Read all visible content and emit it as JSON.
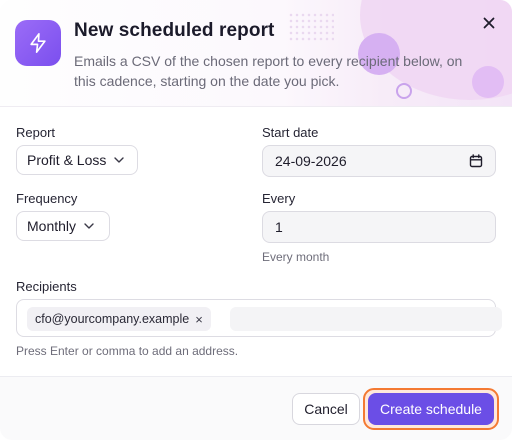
{
  "dialog": {
    "title": "New scheduled report",
    "subtitle": "Emails a CSV of the chosen report to every recipient below, on this cadence, starting on the date you pick.",
    "icon": "bolt-icon",
    "close_icon": "close-icon"
  },
  "form": {
    "report": {
      "label": "Report",
      "value": "Profit & Loss"
    },
    "start_date": {
      "label": "Start date",
      "value": "24-09-2026",
      "icon": "calendar-icon"
    },
    "frequency": {
      "label": "Frequency",
      "value": "Monthly"
    },
    "every": {
      "label": "Every",
      "value": "1",
      "hint": "Every month"
    },
    "recipients": {
      "label": "Recipients",
      "chips": [
        "cfo@yourcompany.example"
      ],
      "remove_glyph": "×",
      "hint": "Press Enter or comma to add an address."
    }
  },
  "footer": {
    "cancel_label": "Cancel",
    "create_label": "Create schedule"
  },
  "colors": {
    "accent": "#6b4ee6",
    "focus_ring": "#f47a33",
    "icon_gradient_start": "#9b6cf7",
    "icon_gradient_end": "#7b4fee"
  }
}
